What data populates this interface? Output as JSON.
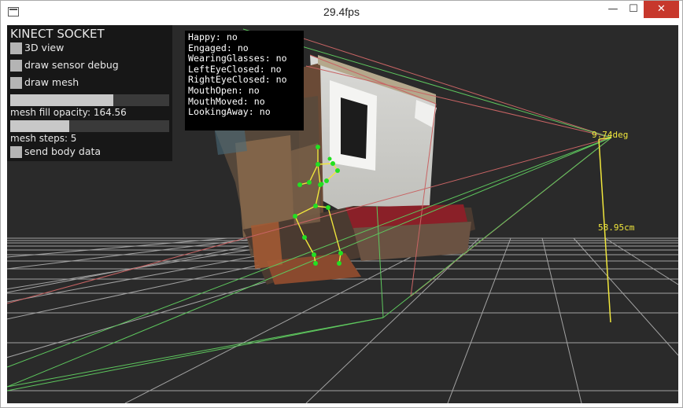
{
  "window": {
    "title": "29.4fps",
    "minimize_glyph": "—",
    "maximize_glyph": "☐",
    "close_glyph": "✕"
  },
  "gui": {
    "title": "KINECT SOCKET",
    "toggles": [
      {
        "label": "3D view",
        "checked": false
      },
      {
        "label": "draw sensor debug",
        "checked": false
      },
      {
        "label": "draw mesh",
        "checked": false
      }
    ],
    "sliders": [
      {
        "label": "mesh fill opacity: 164.56",
        "fill": 0.65
      },
      {
        "label": "mesh steps: 5",
        "fill": 0.37
      }
    ],
    "send_body_label": "send body data"
  },
  "face": {
    "rows": [
      "Happy: no",
      "Engaged: no",
      "WearingGlasses: no",
      "LeftEyeClosed: no",
      "RightEyeClosed: no",
      "MouthOpen: no",
      "MouthMoved: no",
      "LookingAway: no"
    ]
  },
  "hud": {
    "angle": "9.74deg",
    "height": "58.95cm"
  },
  "colors": {
    "viewport_bg": "#2a2a2a",
    "grid": "#b8b8b8",
    "frustum_red": "#c86464",
    "frustum_green": "#5ec85e",
    "measure_yellow": "#f0e63c",
    "skeleton_joint": "#22e022",
    "skeleton_bone": "#f0e63c",
    "close_button": "#c7382c"
  }
}
